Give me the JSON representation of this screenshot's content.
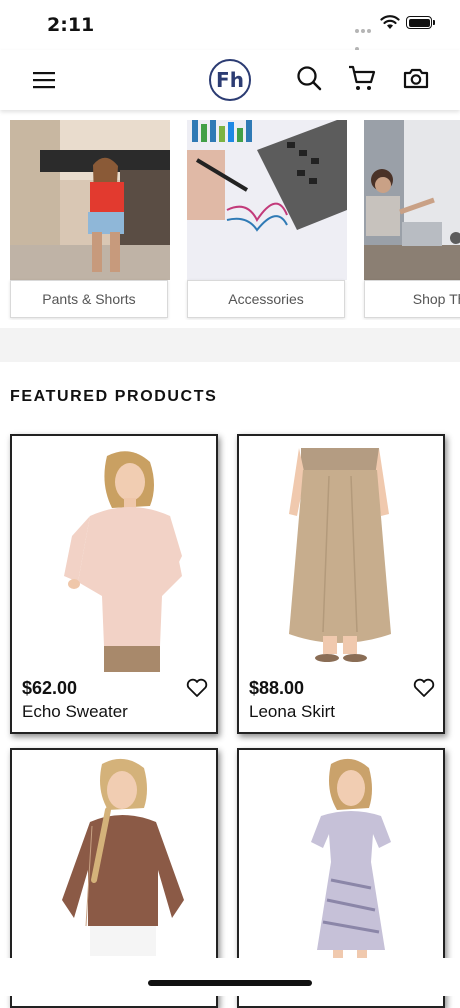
{
  "status_bar": {
    "time": "2:11"
  },
  "header": {
    "logo_text": "Fh"
  },
  "categories": [
    {
      "label": "Pants & Shorts"
    },
    {
      "label": "Accessories"
    },
    {
      "label": "Shop The"
    }
  ],
  "featured": {
    "title": "FEATURED PRODUCTS",
    "products": [
      {
        "price": "$62.00",
        "name": "Echo Sweater"
      },
      {
        "price": "$88.00",
        "name": "Leona Skirt"
      },
      {
        "price": "",
        "name": ""
      },
      {
        "price": "",
        "name": ""
      }
    ]
  },
  "colors": {
    "brand": "#2c3c73",
    "text": "#111111",
    "band": "#f3f3f3"
  }
}
